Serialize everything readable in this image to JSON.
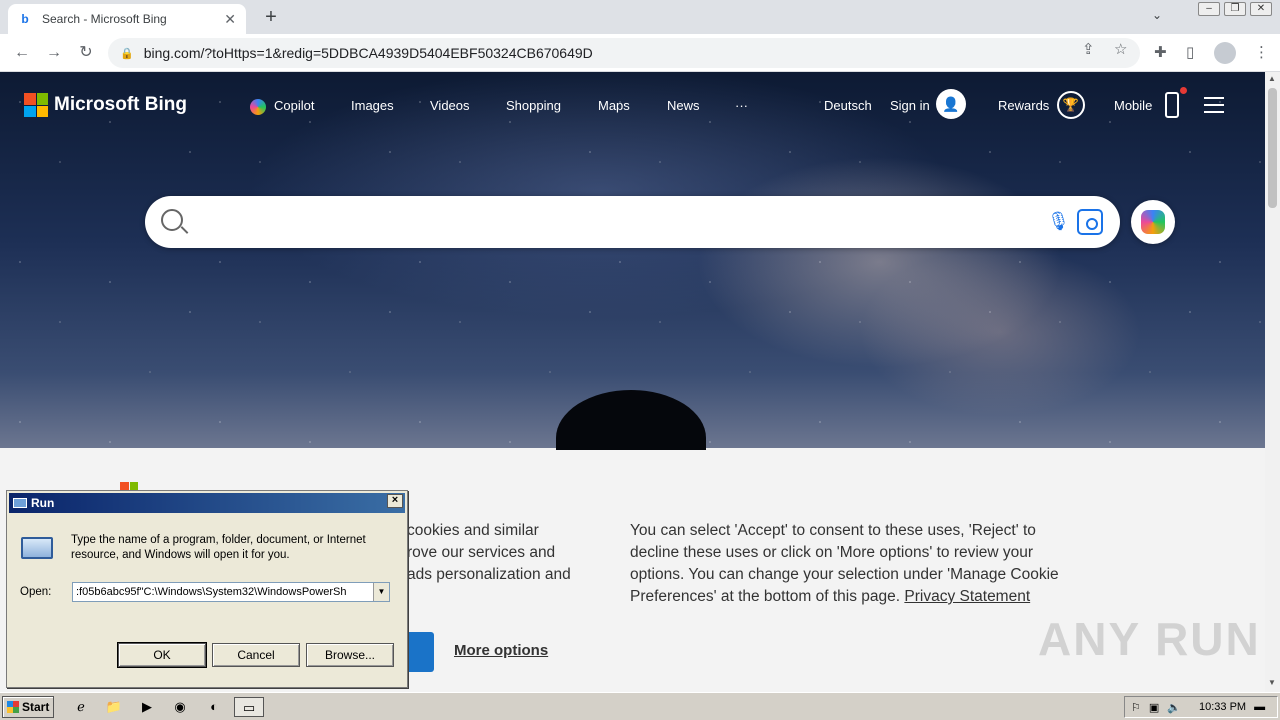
{
  "browser": {
    "tab_title": "Search - Microsoft Bing",
    "tab_favicon": "b",
    "new_tab": "+",
    "url": "bing.com/?toHttps=1&redig=5DDBCA4939D5404EBF50324CB670649D"
  },
  "bing": {
    "logo_text": "Microsoft Bing",
    "nav": [
      "Copilot",
      "Images",
      "Videos",
      "Shopping",
      "Maps",
      "News",
      "···"
    ],
    "language": "Deutsch",
    "sign_in": "Sign in",
    "rewards": "Rewards",
    "mobile": "Mobile",
    "search_value": ""
  },
  "consent": {
    "left_lines": [
      "cookies and similar",
      "rove our services and",
      "ads personalization and"
    ],
    "right_text": "You can select 'Accept' to consent to these uses, 'Reject' to decline these uses or click on 'More options' to review your options. You can change your selection under 'Manage Cookie Preferences' at the bottom of this page.",
    "privacy_link": "Privacy Statement",
    "more_options": "More options"
  },
  "watermark": "ANY RUN",
  "run_dialog": {
    "title": "Run",
    "close": "×",
    "description": "Type the name of a program, folder, document, or Internet resource, and Windows will open it for you.",
    "open_label": "Open:",
    "open_value": ":f05b6abc95f\"C:\\Windows\\System32\\WindowsPowerSh",
    "ok": "OK",
    "cancel": "Cancel",
    "browse": "Browse..."
  },
  "taskbar": {
    "start": "Start",
    "clock": "10:33 PM"
  },
  "colors": {
    "bing_blue": "#1a73c8",
    "chrome_tab_bg": "#dee1e6",
    "win_title": "#0a246a"
  }
}
